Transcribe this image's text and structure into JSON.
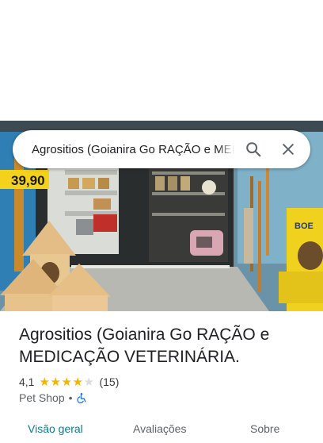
{
  "search": {
    "query": "Agrositios (Goianira Go RAÇÃO e MEDICAÇÃO VETERINÁRIA."
  },
  "hero_photo": {
    "price_tag_text": "39,90",
    "bag_brand_text": "BOE"
  },
  "place": {
    "name": "Agrositios (Goianira Go RAÇÃO e MEDICAÇÃO VETERINÁRIA.",
    "rating": "4,1",
    "rating_value": 4.1,
    "review_count": "(15)",
    "category": "Pet Shop",
    "separator": "•"
  },
  "tabs": [
    {
      "label": "Visão geral",
      "active": true
    },
    {
      "label": "Avaliações",
      "active": false
    },
    {
      "label": "Sobre",
      "active": false
    }
  ],
  "icons": {
    "search": "search-icon",
    "close": "close-icon",
    "accessibility": "wheelchair-icon"
  },
  "colors": {
    "star": "#f4b400",
    "active_tab": "#0b7d8f",
    "accessibility_icon": "#1a73e8"
  }
}
